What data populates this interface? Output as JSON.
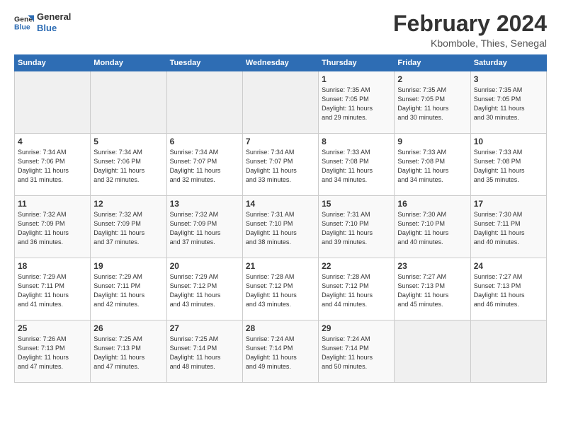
{
  "logo": {
    "line1": "General",
    "line2": "Blue"
  },
  "title": "February 2024",
  "subtitle": "Kbombole, Thies, Senegal",
  "days_header": [
    "Sunday",
    "Monday",
    "Tuesday",
    "Wednesday",
    "Thursday",
    "Friday",
    "Saturday"
  ],
  "weeks": [
    [
      {
        "day": "",
        "info": ""
      },
      {
        "day": "",
        "info": ""
      },
      {
        "day": "",
        "info": ""
      },
      {
        "day": "",
        "info": ""
      },
      {
        "day": "1",
        "info": "Sunrise: 7:35 AM\nSunset: 7:05 PM\nDaylight: 11 hours\nand 29 minutes."
      },
      {
        "day": "2",
        "info": "Sunrise: 7:35 AM\nSunset: 7:05 PM\nDaylight: 11 hours\nand 30 minutes."
      },
      {
        "day": "3",
        "info": "Sunrise: 7:35 AM\nSunset: 7:05 PM\nDaylight: 11 hours\nand 30 minutes."
      }
    ],
    [
      {
        "day": "4",
        "info": "Sunrise: 7:34 AM\nSunset: 7:06 PM\nDaylight: 11 hours\nand 31 minutes."
      },
      {
        "day": "5",
        "info": "Sunrise: 7:34 AM\nSunset: 7:06 PM\nDaylight: 11 hours\nand 32 minutes."
      },
      {
        "day": "6",
        "info": "Sunrise: 7:34 AM\nSunset: 7:07 PM\nDaylight: 11 hours\nand 32 minutes."
      },
      {
        "day": "7",
        "info": "Sunrise: 7:34 AM\nSunset: 7:07 PM\nDaylight: 11 hours\nand 33 minutes."
      },
      {
        "day": "8",
        "info": "Sunrise: 7:33 AM\nSunset: 7:08 PM\nDaylight: 11 hours\nand 34 minutes."
      },
      {
        "day": "9",
        "info": "Sunrise: 7:33 AM\nSunset: 7:08 PM\nDaylight: 11 hours\nand 34 minutes."
      },
      {
        "day": "10",
        "info": "Sunrise: 7:33 AM\nSunset: 7:08 PM\nDaylight: 11 hours\nand 35 minutes."
      }
    ],
    [
      {
        "day": "11",
        "info": "Sunrise: 7:32 AM\nSunset: 7:09 PM\nDaylight: 11 hours\nand 36 minutes."
      },
      {
        "day": "12",
        "info": "Sunrise: 7:32 AM\nSunset: 7:09 PM\nDaylight: 11 hours\nand 37 minutes."
      },
      {
        "day": "13",
        "info": "Sunrise: 7:32 AM\nSunset: 7:09 PM\nDaylight: 11 hours\nand 37 minutes."
      },
      {
        "day": "14",
        "info": "Sunrise: 7:31 AM\nSunset: 7:10 PM\nDaylight: 11 hours\nand 38 minutes."
      },
      {
        "day": "15",
        "info": "Sunrise: 7:31 AM\nSunset: 7:10 PM\nDaylight: 11 hours\nand 39 minutes."
      },
      {
        "day": "16",
        "info": "Sunrise: 7:30 AM\nSunset: 7:10 PM\nDaylight: 11 hours\nand 40 minutes."
      },
      {
        "day": "17",
        "info": "Sunrise: 7:30 AM\nSunset: 7:11 PM\nDaylight: 11 hours\nand 40 minutes."
      }
    ],
    [
      {
        "day": "18",
        "info": "Sunrise: 7:29 AM\nSunset: 7:11 PM\nDaylight: 11 hours\nand 41 minutes."
      },
      {
        "day": "19",
        "info": "Sunrise: 7:29 AM\nSunset: 7:11 PM\nDaylight: 11 hours\nand 42 minutes."
      },
      {
        "day": "20",
        "info": "Sunrise: 7:29 AM\nSunset: 7:12 PM\nDaylight: 11 hours\nand 43 minutes."
      },
      {
        "day": "21",
        "info": "Sunrise: 7:28 AM\nSunset: 7:12 PM\nDaylight: 11 hours\nand 43 minutes."
      },
      {
        "day": "22",
        "info": "Sunrise: 7:28 AM\nSunset: 7:12 PM\nDaylight: 11 hours\nand 44 minutes."
      },
      {
        "day": "23",
        "info": "Sunrise: 7:27 AM\nSunset: 7:13 PM\nDaylight: 11 hours\nand 45 minutes."
      },
      {
        "day": "24",
        "info": "Sunrise: 7:27 AM\nSunset: 7:13 PM\nDaylight: 11 hours\nand 46 minutes."
      }
    ],
    [
      {
        "day": "25",
        "info": "Sunrise: 7:26 AM\nSunset: 7:13 PM\nDaylight: 11 hours\nand 47 minutes."
      },
      {
        "day": "26",
        "info": "Sunrise: 7:25 AM\nSunset: 7:13 PM\nDaylight: 11 hours\nand 47 minutes."
      },
      {
        "day": "27",
        "info": "Sunrise: 7:25 AM\nSunset: 7:14 PM\nDaylight: 11 hours\nand 48 minutes."
      },
      {
        "day": "28",
        "info": "Sunrise: 7:24 AM\nSunset: 7:14 PM\nDaylight: 11 hours\nand 49 minutes."
      },
      {
        "day": "29",
        "info": "Sunrise: 7:24 AM\nSunset: 7:14 PM\nDaylight: 11 hours\nand 50 minutes."
      },
      {
        "day": "",
        "info": ""
      },
      {
        "day": "",
        "info": ""
      }
    ]
  ]
}
